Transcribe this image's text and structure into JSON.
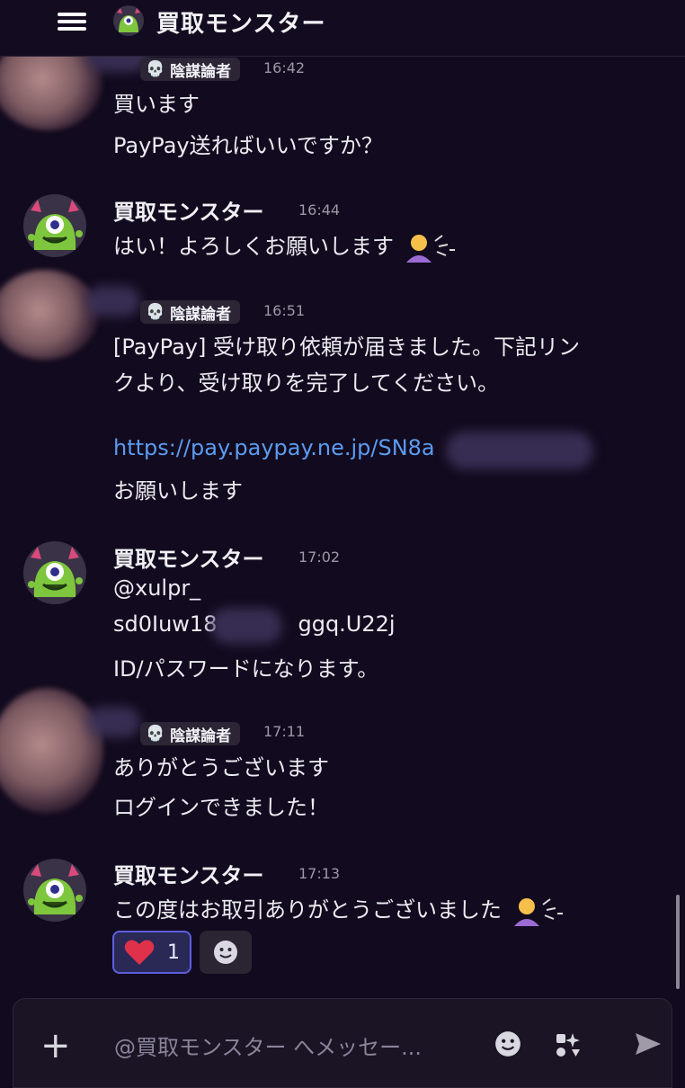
{
  "header": {
    "title": "買取モンスター"
  },
  "messages": [
    {
      "type": "continuation",
      "tag": "陰謀論者",
      "time": "16:42",
      "lines": [
        "買います",
        "PayPay送ればいいですか？"
      ]
    },
    {
      "type": "bot",
      "name": "買取モンスター",
      "time": "16:44",
      "lines": [
        "はい！よろしくお願いします"
      ],
      "emoji": "person-bowing-emoji"
    },
    {
      "type": "user",
      "tag": "陰謀論者",
      "time": "16:51",
      "lines": [
        "[PayPay] 受け取り依頼が届きました。下記リン",
        "クより、受け取りを完了してください。",
        "お願いします"
      ],
      "link": "https://pay.paypay.ne.jp/SN8a"
    },
    {
      "type": "bot",
      "name": "買取モンスター",
      "time": "17:02",
      "lines": [
        "@xulpr_",
        "sd0Iuw18",
        "ggq.U22j",
        "ID/パスワードになります。"
      ]
    },
    {
      "type": "user",
      "tag": "陰謀論者",
      "time": "17:11",
      "lines": [
        "ありがとうございます",
        "ログインできました！"
      ]
    },
    {
      "type": "bot",
      "name": "買取モンスター",
      "time": "17:13",
      "lines": [
        "この度はお取引ありがとうございました"
      ],
      "emoji": "person-bowing-emoji",
      "reactions": [
        {
          "emoji": "heart-icon",
          "count": "1"
        }
      ]
    }
  ],
  "composer": {
    "placeholder": "@買取モンスター へメッセー..."
  },
  "colors": {
    "background": "#120a1e",
    "link": "#5b9cf1",
    "reaction_border": "#5d5fe0",
    "tag_bg": "#2b2535"
  }
}
